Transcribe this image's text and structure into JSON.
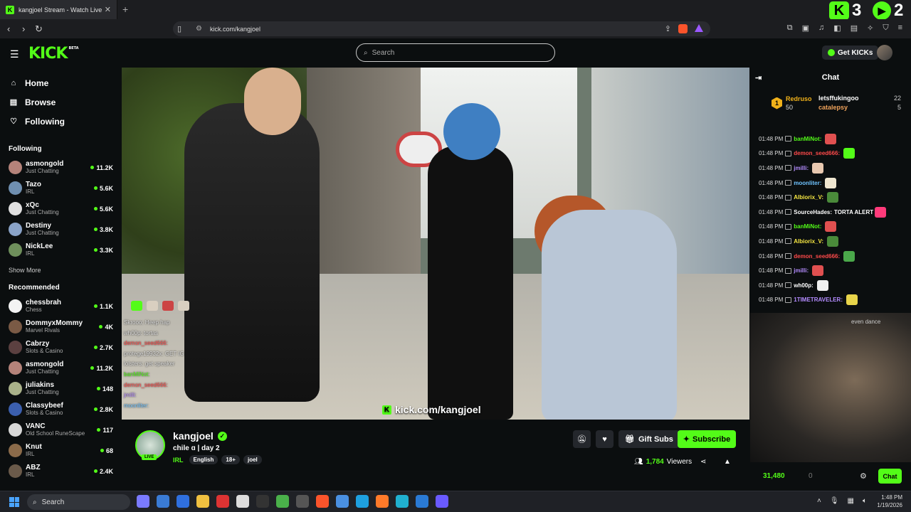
{
  "browser": {
    "tab_title": "kangjoel Stream - Watch Live",
    "url": "kick.com/kangjoel",
    "badge_counts": [
      "3",
      "2"
    ],
    "shield_count": "1"
  },
  "header": {
    "logo": "KICK",
    "logo_beta": "BETA",
    "search_placeholder": "Search",
    "get_kicks": "Get KICKs"
  },
  "sidebar": {
    "nav": [
      {
        "label": "Home",
        "icon": "home-icon"
      },
      {
        "label": "Browse",
        "icon": "browse-icon"
      },
      {
        "label": "Following",
        "icon": "heart-icon"
      }
    ],
    "following_title": "Following",
    "following": [
      {
        "name": "asmongold",
        "category": "Just Chatting",
        "viewers": "11.2K",
        "color": "#b5837a"
      },
      {
        "name": "Tazo",
        "category": "IRL",
        "viewers": "5.6K",
        "color": "#6f8fb0"
      },
      {
        "name": "xQc",
        "category": "Just Chatting",
        "viewers": "5.6K",
        "color": "#e0e0e0"
      },
      {
        "name": "Destiny",
        "category": "Just Chatting",
        "viewers": "3.8K",
        "color": "#8aa3c8"
      },
      {
        "name": "NickLee",
        "category": "IRL",
        "viewers": "3.3K",
        "color": "#6e8f5b"
      }
    ],
    "show_more": "Show More",
    "recommended_title": "Recommended",
    "recommended": [
      {
        "name": "chessbrah",
        "category": "Chess",
        "viewers": "1.1K",
        "color": "#f3f3f3"
      },
      {
        "name": "DommyxMommy",
        "category": "Marvel Rivals",
        "viewers": "4K",
        "color": "#7a5a45"
      },
      {
        "name": "Cabrzy",
        "category": "Slots & Casino",
        "viewers": "2.7K",
        "color": "#5b4040"
      },
      {
        "name": "asmongold",
        "category": "Just Chatting",
        "viewers": "11.2K",
        "color": "#b5837a"
      },
      {
        "name": "juliakins",
        "category": "Just Chatting",
        "viewers": "148",
        "color": "#aab28a"
      },
      {
        "name": "Classybeef",
        "category": "Slots & Casino",
        "viewers": "2.8K",
        "color": "#3b5fae"
      },
      {
        "name": "VANC",
        "category": "Old School RuneScape",
        "viewers": "117",
        "color": "#d8d8d8"
      },
      {
        "name": "Knut",
        "category": "IRL",
        "viewers": "68",
        "color": "#8b6b4a"
      },
      {
        "name": "ABZ",
        "category": "IRL",
        "viewers": "2.4K",
        "color": "#6a5a4a"
      }
    ]
  },
  "video": {
    "watermark": "kick.com/kangjoel",
    "overlay_chat": [
      {
        "text": "Skrooo: Heep hap",
        "color": "#ddd"
      },
      {
        "text": "wh00p: tortas",
        "color": "#ddd"
      },
      {
        "text": "demon_seed666:",
        "color": "#ff4a4a"
      },
      {
        "text": "protege19932x: GET IG",
        "color": "#ddd"
      },
      {
        "text": "lolsters: get speaker",
        "color": "#ddd"
      },
      {
        "text": "banMiNot:",
        "color": "#53fc18"
      },
      {
        "text": "demon_seed666:",
        "color": "#ff4a4a"
      },
      {
        "text": "jmilli:",
        "color": "#b48cff"
      },
      {
        "text": "moonliter:",
        "color": "#6fc3ff"
      }
    ]
  },
  "stream": {
    "streamer": "kangjoel",
    "live_label": "LIVE",
    "title": "chile ɑ | day 2",
    "category": "IRL",
    "tags": [
      "English",
      "18+",
      "joel"
    ],
    "gift_subs": "Gift Subs",
    "subscribe": "Subscribe",
    "viewers_count": "1,784",
    "viewers_label": "Viewers"
  },
  "chat": {
    "title": "Chat",
    "leaders": {
      "top": {
        "rank": "1",
        "name": "Redruso",
        "count": "50"
      },
      "others": [
        {
          "name": "letsffukingoo",
          "count": "22"
        },
        {
          "name": "catalepsy",
          "count": "5"
        }
      ]
    },
    "messages": [
      {
        "time": "01:48 PM",
        "user": "banMiNot:",
        "color": "#53fc18",
        "text": "",
        "emote": "#e05050"
      },
      {
        "time": "01:48 PM",
        "user": "demon_seed666:",
        "color": "#ff4a4a",
        "text": "",
        "emote": "#53fc18"
      },
      {
        "time": "01:48 PM",
        "user": "jmilli:",
        "color": "#b48cff",
        "text": "",
        "emote": "#e8c8b0"
      },
      {
        "time": "01:48 PM",
        "user": "moonliter:",
        "color": "#6fc3ff",
        "text": "",
        "emote": "#efe6d0"
      },
      {
        "time": "01:48 PM",
        "user": "Albiorix_V:",
        "color": "#f5e642",
        "text": "",
        "emote": "#4a8a3a"
      },
      {
        "time": "01:48 PM",
        "user": "SourceHades:",
        "color": "#ffffff",
        "text": "TORTA ALERT",
        "emote": "#ff3a7a"
      },
      {
        "time": "01:48 PM",
        "user": "banMiNot:",
        "color": "#53fc18",
        "text": "",
        "emote": "#e05050"
      },
      {
        "time": "01:48 PM",
        "user": "Albiorix_V:",
        "color": "#f5e642",
        "text": "",
        "emote": "#4a8a3a"
      },
      {
        "time": "01:48 PM",
        "user": "demon_seed666:",
        "color": "#ff4a4a",
        "text": "",
        "emote": "#4aa84a"
      },
      {
        "time": "01:48 PM",
        "user": "jmilli:",
        "color": "#b48cff",
        "text": "",
        "emote": "#e05050"
      },
      {
        "time": "01:48 PM",
        "user": "wh00p:",
        "color": "#ffffff",
        "text": "",
        "emote": "#f0f0f0"
      },
      {
        "time": "01:48 PM",
        "user": "1TIMETRAVELER:",
        "color": "#b48cff",
        "text": "",
        "emote": "#e8d44a"
      }
    ],
    "partial_text": "even dance",
    "kicks": "31,480",
    "gifts": "0",
    "button": "Chat"
  },
  "taskbar": {
    "search": "Search",
    "time": "1:48 PM",
    "date": "1/19/2026",
    "apps": [
      "#7a7aff",
      "#3a7bd5",
      "#2f6fde",
      "#f0c040",
      "#d33",
      "#ddd",
      "#333",
      "#4ab04a",
      "#555",
      "#fb542b",
      "#4a90e2",
      "#1ea0e0",
      "#ff7a2a",
      "#20b0d0",
      "#2a7ad5",
      "#6a5aff"
    ]
  },
  "colors": {
    "accent": "#53fc18",
    "bg": "#0b0e0f",
    "panel": "#24272c"
  }
}
